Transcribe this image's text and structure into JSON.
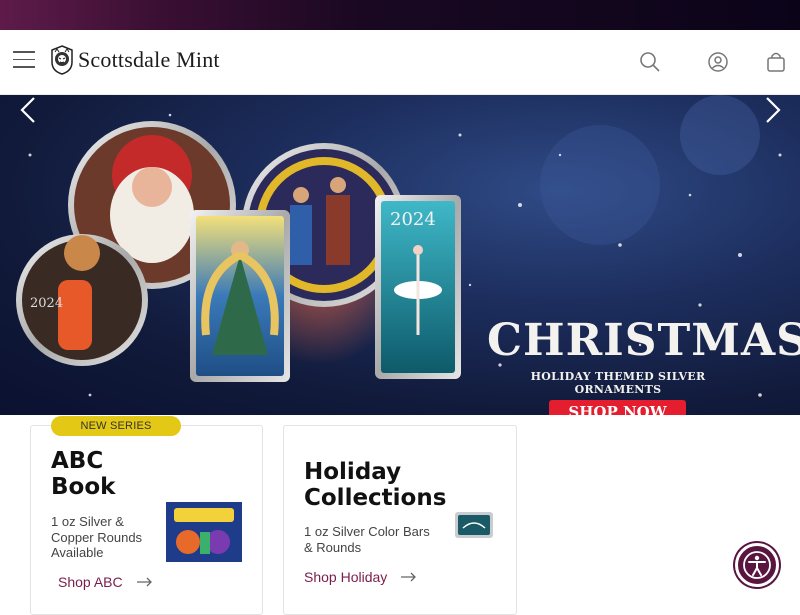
{
  "header": {
    "brand": "Scottsdale Mint",
    "icons": [
      "menu-icon",
      "search-icon",
      "account-icon",
      "cart-icon"
    ]
  },
  "hero": {
    "title": "CHRISTMAS",
    "subtitle": "HOLIDAY THEMED SILVER ORNAMENTS",
    "cta": "SHOP NOW",
    "coin_year_1": "2024",
    "coin_year_2": "2024",
    "bar_year": "2024",
    "prev_icon": "chevron-left-icon",
    "next_icon": "chevron-right-icon",
    "accent": "#e41d2f"
  },
  "cards": [
    {
      "badge": "NEW SERIES",
      "title_line1": "ABC",
      "title_line2": "Book",
      "desc_line1": "1 oz Silver &",
      "desc_line2": "Copper Rounds",
      "desc_line3": "Available",
      "link": "Shop ABC"
    },
    {
      "title_line1": "Holiday",
      "title_line2": "Collections",
      "desc_line1": "1 oz Silver Color Bars",
      "desc_line2": "& Rounds",
      "link": "Shop Holiday"
    }
  ],
  "colors": {
    "brand_plum": "#7a1d4d",
    "badge_yellow": "#e3c915",
    "cta_red": "#e41d2f"
  }
}
